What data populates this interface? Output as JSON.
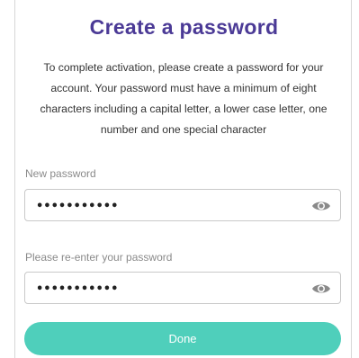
{
  "title": "Create a password",
  "description": "To complete activation, please create a password for your account. Your password must have a minimum of eight characters including a capital letter, a lower case letter, one number and one special character",
  "new_password": {
    "label": "New password",
    "value": "Password1!a",
    "icon": "eye-icon"
  },
  "confirm_password": {
    "label": "Please re-enter your password",
    "value": "Password1!a",
    "icon": "eye-icon"
  },
  "done_button": {
    "label": "Done"
  },
  "colors": {
    "title": "#4b3a96",
    "button": "#4fcfbb",
    "icon": "#8a8a8a"
  }
}
